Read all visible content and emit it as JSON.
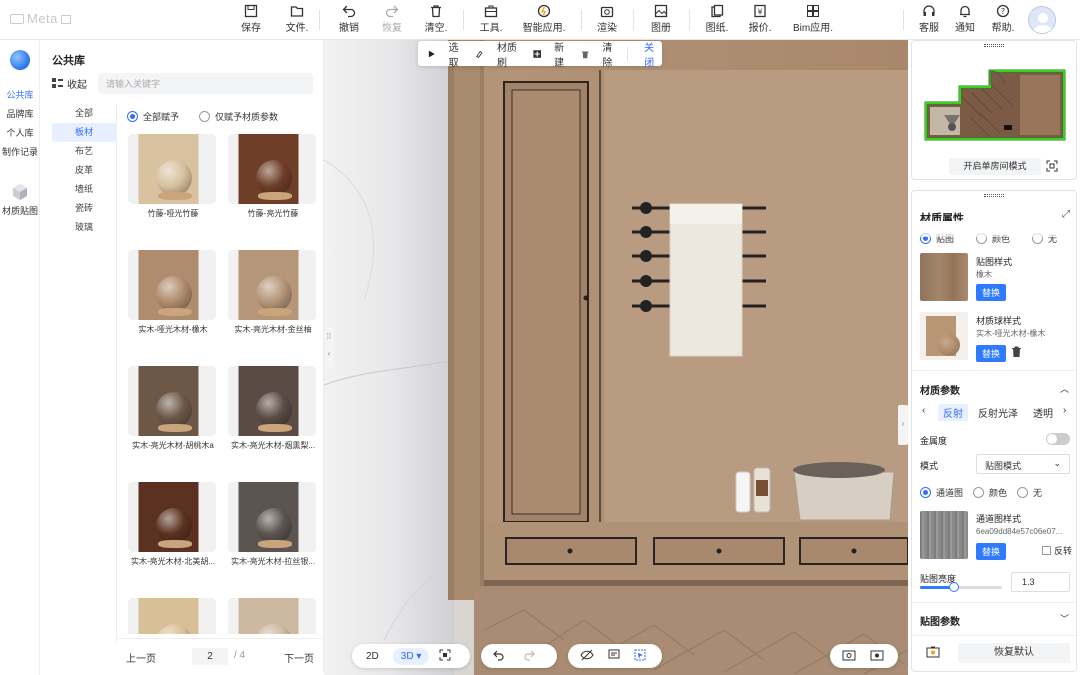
{
  "app": {
    "logo": "Meta"
  },
  "toolbar": {
    "items": [
      {
        "label": "保存",
        "icon": "save-icon"
      },
      {
        "label": "文件.",
        "icon": "folder-icon"
      },
      {
        "label": "撤销",
        "icon": "undo-icon"
      },
      {
        "label": "恢复",
        "icon": "redo-icon"
      },
      {
        "label": "清空.",
        "icon": "trash-icon"
      },
      {
        "label": "工具.",
        "icon": "toolbox-icon"
      },
      {
        "label": "智能应用.",
        "icon": "smart-bulb-icon"
      },
      {
        "label": "渲染",
        "icon": "camera-icon"
      },
      {
        "label": "图册",
        "icon": "album-icon"
      },
      {
        "label": "图纸.",
        "icon": "drawings-icon"
      },
      {
        "label": "报价.",
        "icon": "quote-icon"
      },
      {
        "label": "Bim应用.",
        "icon": "bim-icon"
      }
    ],
    "right": [
      {
        "label": "客服",
        "icon": "headset-icon"
      },
      {
        "label": "通知",
        "icon": "bell-icon"
      },
      {
        "label": "帮助.",
        "icon": "help-icon"
      }
    ]
  },
  "rail": {
    "items": [
      "公共库",
      "品牌库",
      "个人库",
      "制作记录"
    ],
    "material_map": "材质贴图"
  },
  "library": {
    "title": "公共库",
    "collapse": "收起",
    "search_placeholder": "请输入关键字",
    "categories": [
      "全部",
      "板材",
      "布艺",
      "皮革",
      "墙纸",
      "瓷砖",
      "玻璃"
    ],
    "active_category": "板材",
    "radio": {
      "all": "全部赋予",
      "params_only": "仅赋予材质参数"
    },
    "items": [
      {
        "name": "竹藤-哑光竹藤",
        "color": "#d8c29f"
      },
      {
        "name": "竹藤-亮光竹藤",
        "color": "#6e3e28"
      },
      {
        "name": "实木-哑光木材-橡木",
        "color": "#b08c6e"
      },
      {
        "name": "实木-亮光木材-金丝柚",
        "color": "#b59678"
      },
      {
        "name": "实木-亮光木材-胡桃木a",
        "color": "#6d5848"
      },
      {
        "name": "实木-亮光木材-烟熏梨...",
        "color": "#5a4b45"
      },
      {
        "name": "实木-亮光木材-北美胡...",
        "color": "#5b3221"
      },
      {
        "name": "实木-亮光木材-拉丝银...",
        "color": "#5c5450"
      },
      {
        "name": "",
        "color": "#d9bf96"
      },
      {
        "name": "",
        "color": "#cdb9a2"
      }
    ],
    "pager": {
      "prev": "上一页",
      "current": "2",
      "total": "/ 4",
      "next": "下一页"
    }
  },
  "viewport": {
    "tools": {
      "select": "选取",
      "brush": "材质刷",
      "new": "新建",
      "clear": "清除",
      "close": "关闭"
    },
    "view_2d": "2D",
    "view_3d": "3D"
  },
  "minimap": {
    "single_room": "开启单房间模式"
  },
  "material_panel": {
    "title": "材质属性",
    "top_radio": [
      "贴图",
      "颜色",
      "无"
    ],
    "map_style": {
      "label": "贴图样式",
      "value": "橡木",
      "button": "替换"
    },
    "ball_style": {
      "label": "材质球样式",
      "value": "实木-哑光木材-橡木",
      "button": "替换"
    },
    "params": {
      "title": "材质参数",
      "tabs": [
        "反射",
        "反射光泽",
        "透明"
      ],
      "metalness": "金属度",
      "mode_label": "模式",
      "mode_value": "贴图模式",
      "mode_radio": [
        "通道图",
        "颜色",
        "无"
      ],
      "channel": {
        "label": "通道图样式",
        "value": "6ea09dd84e57c06e07...",
        "button": "替换",
        "invert": "反转"
      },
      "brightness_label": "贴图亮度",
      "brightness_value": "1.3",
      "brightness_level": 0.42
    },
    "map_params": "贴图参数",
    "restore": "恢复默认"
  }
}
